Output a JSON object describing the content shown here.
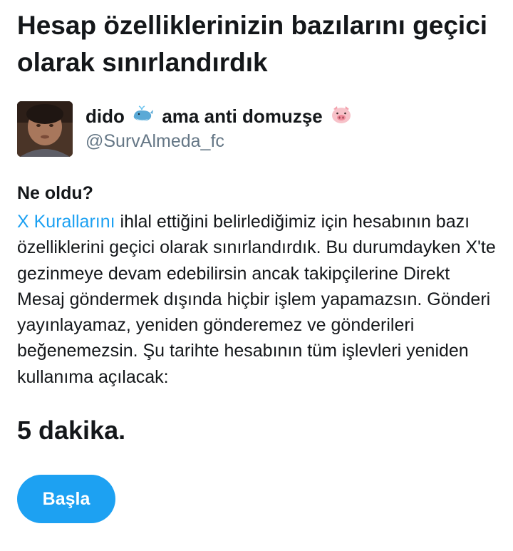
{
  "title": "Hesap özelliklerinizin bazılarını geçici olarak sınırlandırdık",
  "account": {
    "name_part1": "dido",
    "name_emoji1": "whale-emoji",
    "name_part2": "ama anti domuzşe",
    "name_emoji2": "pig-face-emoji",
    "handle": "@SurvAlmeda_fc"
  },
  "section": {
    "heading": "Ne oldu?",
    "link_text": "X Kurallarını",
    "body": " ihlal ettiğini belirlediğimiz için hesabının bazı özelliklerini geçici olarak sınırlandırdık. Bu durumdayken X'te gezinmeye devam edebilirsin ancak takipçilerine Direkt Mesaj göndermek dışında hiçbir işlem yapamazsın. Gönderi yayınlayamaz, yeniden gönderemez ve gönderileri beğenemezsin. Şu tarihte hesabının tüm işlevleri yeniden kullanıma açılacak:"
  },
  "duration": "5 dakika.",
  "button": {
    "label": "Başla"
  },
  "colors": {
    "accent": "#1da1f2",
    "text": "#14171a",
    "muted": "#657786"
  }
}
